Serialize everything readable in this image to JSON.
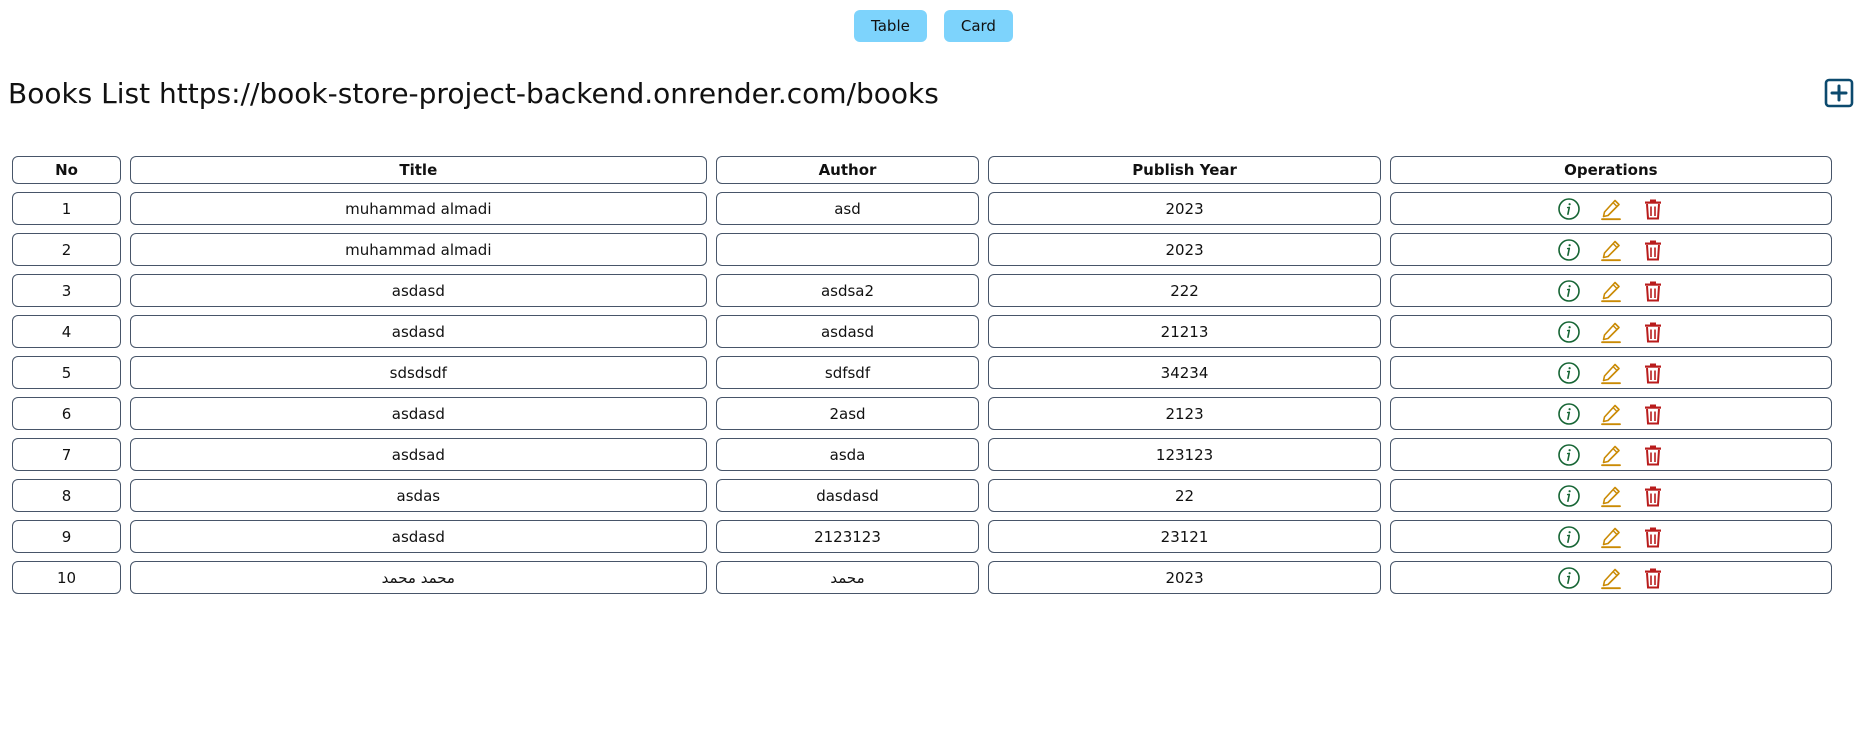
{
  "view_toggle": {
    "table_label": "Table",
    "card_label": "Card"
  },
  "header": {
    "title": "Books List https://book-store-project-backend.onrender.com/books",
    "add_icon": "plus-square-icon"
  },
  "table": {
    "columns": [
      "No",
      "Title",
      "Author",
      "Publish Year",
      "Operations"
    ],
    "rows": [
      {
        "no": "1",
        "title": "muhammad almadi",
        "author": "asd",
        "year": "2023"
      },
      {
        "no": "2",
        "title": "muhammad almadi",
        "author": "",
        "year": "2023"
      },
      {
        "no": "3",
        "title": "asdasd",
        "author": "asdsa2",
        "year": "222"
      },
      {
        "no": "4",
        "title": "asdasd",
        "author": "asdasd",
        "year": "21213"
      },
      {
        "no": "5",
        "title": "sdsdsdf",
        "author": "sdfsdf",
        "year": "34234"
      },
      {
        "no": "6",
        "title": "asdasd",
        "author": "2asd",
        "year": "2123"
      },
      {
        "no": "7",
        "title": "asdsad",
        "author": "asda",
        "year": "123123"
      },
      {
        "no": "8",
        "title": "asdas",
        "author": "dasdasd",
        "year": "22"
      },
      {
        "no": "9",
        "title": "asdasd",
        "author": "2123123",
        "year": "23121"
      },
      {
        "no": "10",
        "title": "محمد محمد",
        "author": "محمد",
        "year": "2023"
      }
    ],
    "operation_icons": [
      "info-circle-icon",
      "edit-pencil-icon",
      "trash-icon"
    ]
  },
  "colors": {
    "toggle_button_bg": "#7dd3fc",
    "add_icon": "#0c4a6e",
    "info_icon": "#166534",
    "edit_icon": "#ca8a04",
    "delete_icon": "#b91c1c",
    "cell_border": "#475569"
  }
}
